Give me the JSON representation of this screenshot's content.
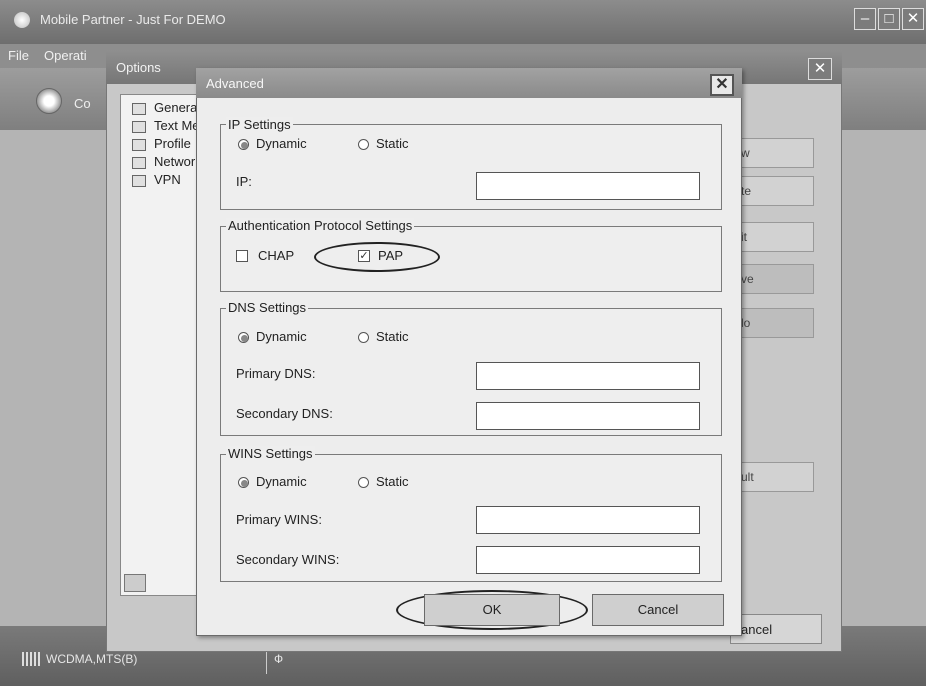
{
  "main": {
    "title": "Mobile Partner - Just For DEMO",
    "menu": [
      "File",
      "Operati"
    ],
    "toolbar_label": "Co",
    "status_network": "WCDMA,MTS(B)",
    "status_mode": "Ф"
  },
  "options": {
    "title": "Options",
    "tree": [
      "Genera",
      "Text Me",
      "Profile",
      "Networ",
      "VPN"
    ],
    "side_buttons": [
      "w",
      "te",
      "it",
      "ve",
      "lo",
      "ult"
    ],
    "cancel_label": "ancel"
  },
  "advanced": {
    "title": "Advanced",
    "close_glyph": "✕",
    "ip": {
      "legend": "IP Settings",
      "dynamic": "Dynamic",
      "static": "Static",
      "ip_label": "IP:",
      "ip_value": "",
      "selected": "dynamic"
    },
    "auth": {
      "legend": "Authentication Protocol Settings",
      "chap": "CHAP",
      "pap": "PAP",
      "chap_checked": false,
      "pap_checked": true,
      "check_glyph": "✓"
    },
    "dns": {
      "legend": "DNS Settings",
      "dynamic": "Dynamic",
      "static": "Static",
      "primary_label": "Primary DNS:",
      "secondary_label": "Secondary DNS:",
      "primary_value": "",
      "secondary_value": "",
      "selected": "dynamic"
    },
    "wins": {
      "legend": "WINS Settings",
      "dynamic": "Dynamic",
      "static": "Static",
      "primary_label": "Primary WINS:",
      "secondary_label": "Secondary WINS:",
      "primary_value": "",
      "secondary_value": "",
      "selected": "dynamic"
    },
    "ok_label": "OK",
    "cancel_label": "Cancel"
  }
}
